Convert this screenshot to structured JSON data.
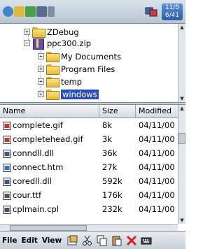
{
  "taskbar": {
    "time_line1": "11/5",
    "time_line2": "6/41"
  },
  "tree": {
    "items": [
      {
        "label": "ZDebug",
        "expander": "+"
      },
      {
        "label": "ppc300.zip",
        "expander": "−"
      },
      {
        "label": "My Documents",
        "expander": "+"
      },
      {
        "label": "Program Files",
        "expander": "+"
      },
      {
        "label": "temp",
        "expander": "+"
      },
      {
        "label": "windows",
        "expander": "+"
      }
    ]
  },
  "list": {
    "columns": [
      "Name",
      "Size",
      "Modified"
    ],
    "rows": [
      {
        "name": "complete.gif",
        "size": "8k",
        "modified": "04/11/00",
        "icon": "gif-file-icon"
      },
      {
        "name": "completehead.gif",
        "size": "3k",
        "modified": "04/11/00",
        "icon": "gif-file-icon"
      },
      {
        "name": "conndll.dll",
        "size": "36k",
        "modified": "04/11/00",
        "icon": "dll-file-icon"
      },
      {
        "name": "connect.htm",
        "size": "27k",
        "modified": "04/11/00",
        "icon": "htm-file-icon"
      },
      {
        "name": "coredll.dll",
        "size": "592k",
        "modified": "04/11/00",
        "icon": "dll-file-icon"
      },
      {
        "name": "cour.ttf",
        "size": "176k",
        "modified": "04/11/00",
        "icon": "font-file-icon"
      },
      {
        "name": "cplmain.cpl",
        "size": "232k",
        "modified": "04/11/00",
        "icon": "cpl-file-icon"
      }
    ]
  },
  "menubar": {
    "file": "File",
    "edit": "Edit",
    "view": "View"
  },
  "colors": {
    "selection": "#2a4fb0",
    "delete_red": "#d42020"
  }
}
